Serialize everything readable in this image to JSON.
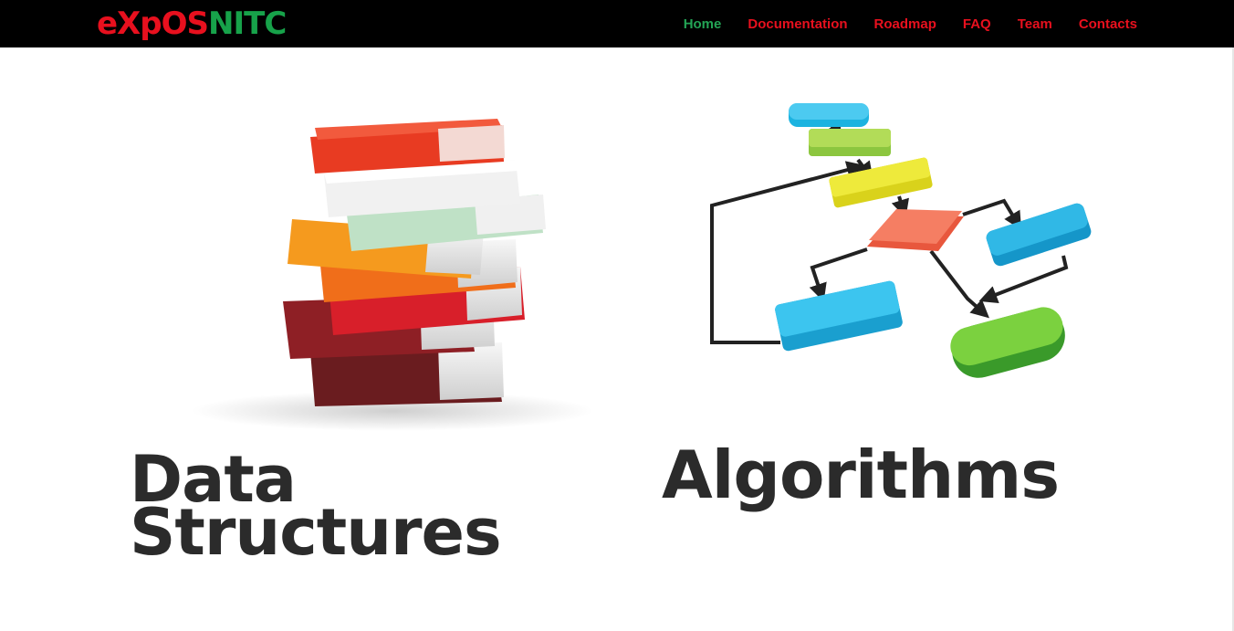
{
  "brand": {
    "part1": "eXpOS",
    "part2": "NITC"
  },
  "nav": {
    "items": [
      {
        "label": "Home",
        "active": true
      },
      {
        "label": "Documentation"
      },
      {
        "label": "Roadmap"
      },
      {
        "label": "FAQ"
      },
      {
        "label": "Team"
      },
      {
        "label": "Contacts"
      }
    ]
  },
  "sections": {
    "data_structures": {
      "line1": "Data",
      "line2": "Structures"
    },
    "algorithms": {
      "title": "Algorithms"
    }
  },
  "colors": {
    "nav_active": "#23a455",
    "nav_link": "#e8101e",
    "brand_red": "#e8101e",
    "brand_green": "#17a24a",
    "heading": "#2b2b2b"
  }
}
